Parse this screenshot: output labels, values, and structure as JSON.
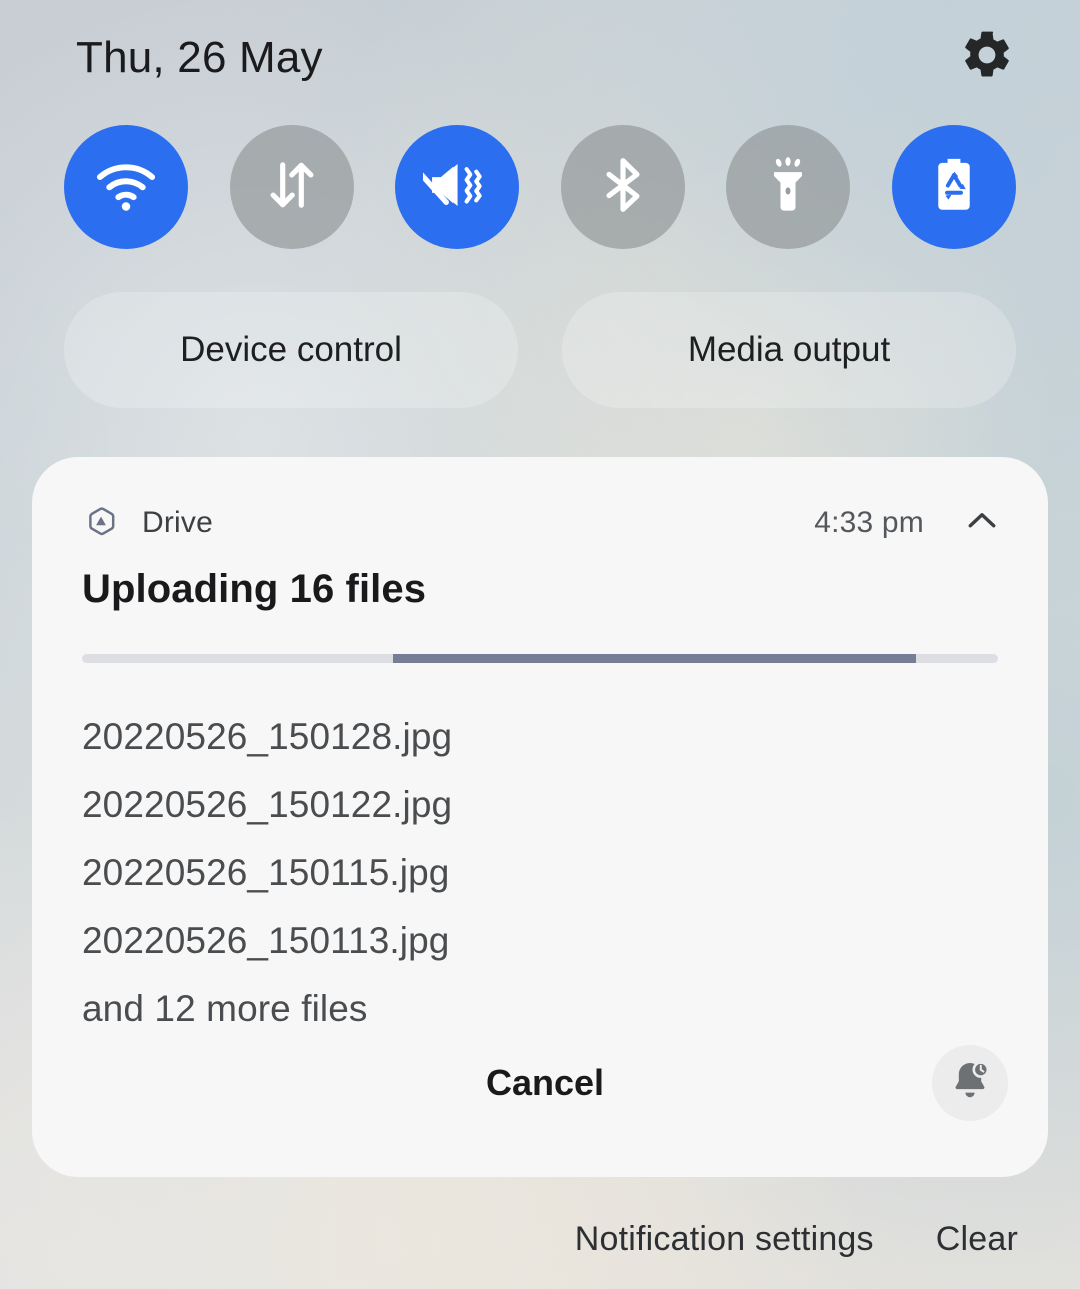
{
  "status_bar": {
    "date": "Thu, 26 May",
    "settings_icon": "gear-icon"
  },
  "quick_settings": {
    "toggles": [
      {
        "name": "wifi",
        "icon": "wifi-icon",
        "state": "on",
        "active_color": "#2B6FF0"
      },
      {
        "name": "mobile-data",
        "icon": "data-arrows-icon",
        "state": "off",
        "active_color": "#8C9193"
      },
      {
        "name": "sound-mode",
        "icon": "mute-vibrate-icon",
        "state": "on",
        "active_color": "#2B6FF0"
      },
      {
        "name": "bluetooth",
        "icon": "bluetooth-icon",
        "state": "off",
        "active_color": "#8C9193"
      },
      {
        "name": "flashlight",
        "icon": "flashlight-icon",
        "state": "off",
        "active_color": "#8C9193"
      },
      {
        "name": "power-saving",
        "icon": "battery-saver-icon",
        "state": "on",
        "active_color": "#2B6FF0"
      }
    ],
    "pills": [
      {
        "label": "Device control"
      },
      {
        "label": "Media output"
      }
    ]
  },
  "notification": {
    "app_icon": "drive-icon",
    "app_name": "Drive",
    "time": "4:33 pm",
    "collapse_icon": "chevron-up-icon",
    "title": "Uploading 16 files",
    "progress": {
      "start_percent": 34,
      "end_percent": 91,
      "indeterminate": true,
      "fill_color": "#757E95",
      "track_color": "#DCDEE3"
    },
    "files": [
      "20220526_150128.jpg",
      "20220526_150122.jpg",
      "20220526_150115.jpg",
      "20220526_150113.jpg"
    ],
    "more_files_label": "and 12 more files",
    "cancel_label": "Cancel",
    "snooze_icon": "bell-clock-icon"
  },
  "footer": {
    "notification_settings_label": "Notification settings",
    "clear_label": "Clear"
  }
}
